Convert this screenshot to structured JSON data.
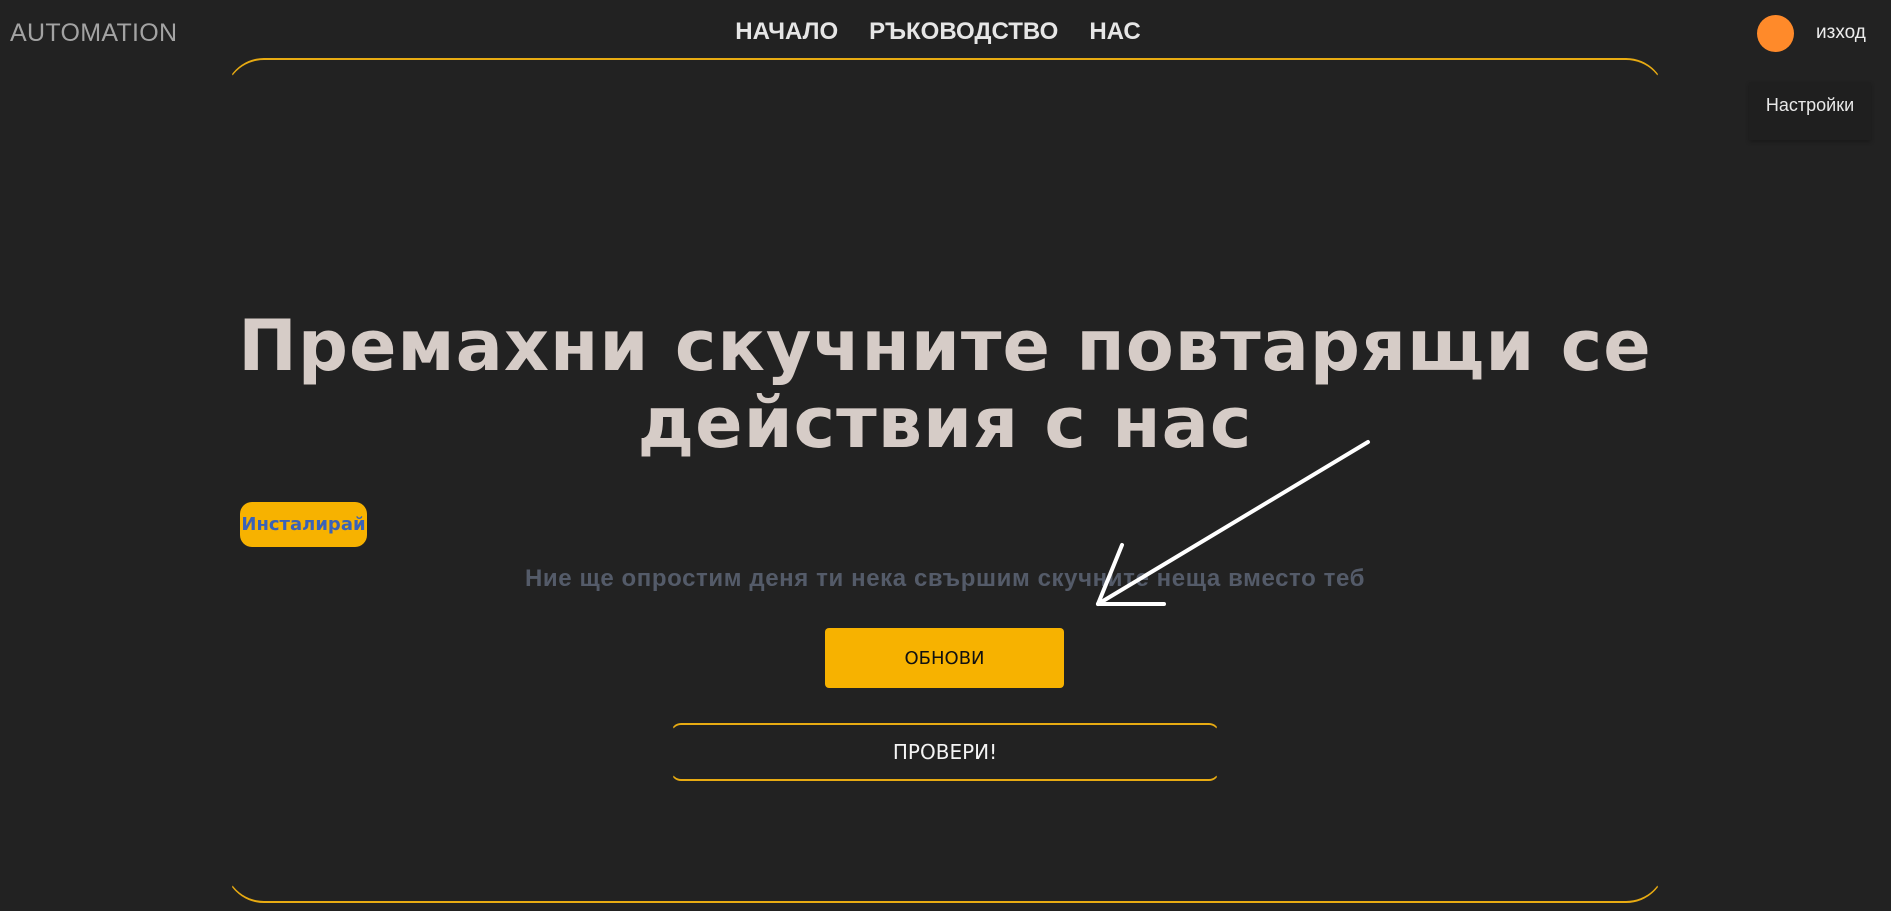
{
  "header": {
    "brand": "AUTOMATION",
    "nav": [
      {
        "label": "НАЧАЛО"
      },
      {
        "label": "РЪКОВОДСТВО"
      },
      {
        "label": "НАС"
      }
    ],
    "avatar_color": "#ff8a2a",
    "logout_label": "изход",
    "settings_label": "Настройки"
  },
  "hero": {
    "headline": "Премахни скучните повтарящи се действия с нас",
    "install_label": "Инсталирай",
    "subtitle": "Ние ще опростим деня ти нека свършим скучните неща вместо теб",
    "refresh_label": "ОБНОВИ",
    "check_label": "ПРОВЕРИ!"
  },
  "colors": {
    "background": "#222222",
    "accent": "#f7b200",
    "frame_border": "#e8ab12",
    "headline": "#d6ccc7",
    "subtitle": "#545b69",
    "install_text": "#3a62b8"
  },
  "icons": {
    "annotation": "arrow-annotation-icon"
  }
}
